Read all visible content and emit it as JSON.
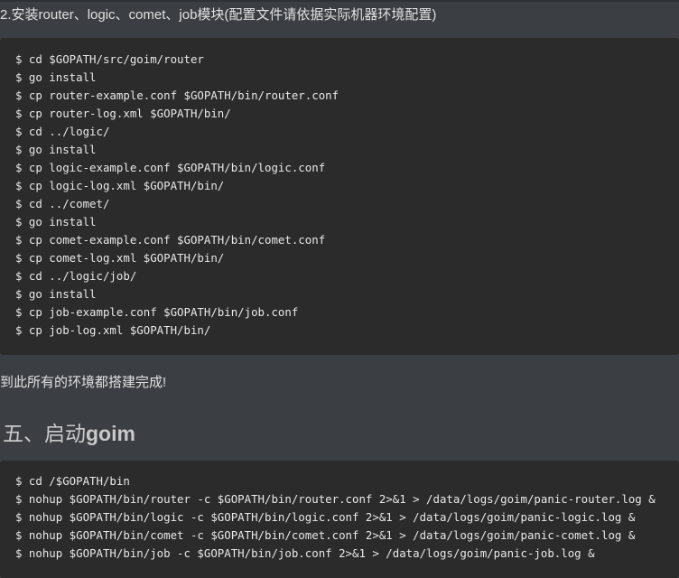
{
  "step2_heading": "2.安装router、logic、comet、job模块(配置文件请依据实际机器环境配置)",
  "install_code": [
    "$ cd $GOPATH/src/goim/router",
    "$ go install",
    "$ cp router-example.conf $GOPATH/bin/router.conf",
    "$ cp router-log.xml $GOPATH/bin/",
    "$ cd ../logic/",
    "$ go install",
    "$ cp logic-example.conf $GOPATH/bin/logic.conf",
    "$ cp logic-log.xml $GOPATH/bin/",
    "$ cd ../comet/",
    "$ go install",
    "$ cp comet-example.conf $GOPATH/bin/comet.conf",
    "$ cp comet-log.xml $GOPATH/bin/",
    "$ cd ../logic/job/",
    "$ go install",
    "$ cp job-example.conf $GOPATH/bin/job.conf",
    "$ cp job-log.xml $GOPATH/bin/"
  ],
  "done_text": "到此所有的环境都搭建完成!",
  "section5": {
    "prefix": "五、启动",
    "name": "goim"
  },
  "start_code": [
    "$ cd /$GOPATH/bin",
    "$ nohup $GOPATH/bin/router -c $GOPATH/bin/router.conf 2>&1 > /data/logs/goim/panic-router.log &",
    "$ nohup $GOPATH/bin/logic -c $GOPATH/bin/logic.conf 2>&1 > /data/logs/goim/panic-logic.log &",
    "$ nohup $GOPATH/bin/comet -c $GOPATH/bin/comet.conf 2>&1 > /data/logs/goim/panic-comet.log &",
    "$ nohup $GOPATH/bin/job -c $GOPATH/bin/job.conf 2>&1 > /data/logs/goim/panic-job.log &"
  ]
}
